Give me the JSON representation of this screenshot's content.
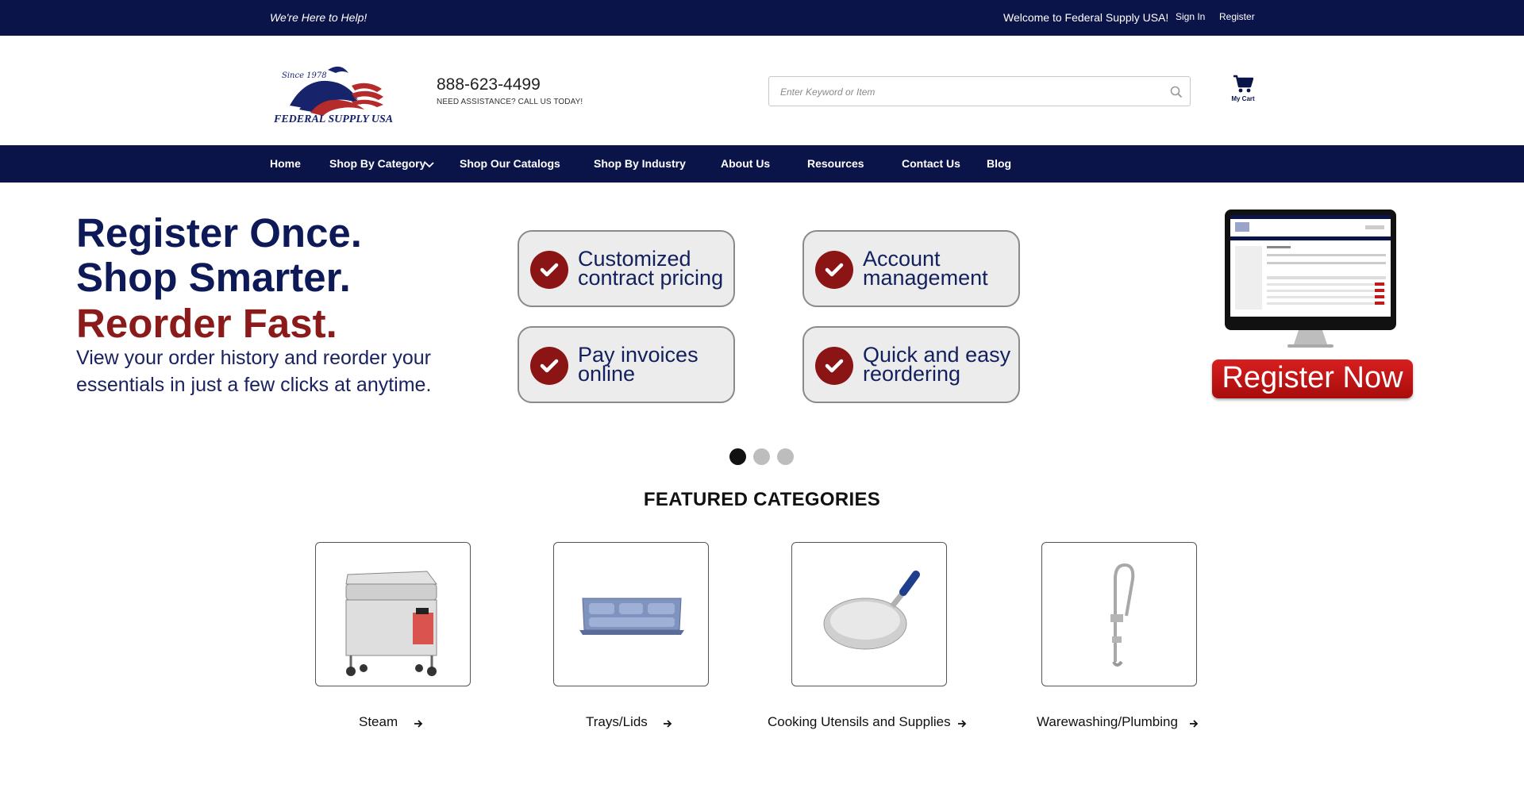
{
  "topbar": {
    "tagline": "We're Here to Help!",
    "welcome": "Welcome to Federal Supply USA!",
    "sign_in": "Sign In",
    "register": "Register"
  },
  "header": {
    "logo_text": "FEDERAL SUPPLY USA",
    "logo_since": "Since 1978",
    "phone": "888-623-4499",
    "assist": "NEED ASSISTANCE? CALL US TODAY!",
    "search_placeholder": "Enter Keyword or Item",
    "search_icon": "search-icon",
    "cart_label": "My Cart",
    "cart_icon": "cart-icon"
  },
  "nav": {
    "items": [
      "Home",
      "Shop By Category",
      "Shop Our Catalogs",
      "Shop By Industry",
      "About Us",
      "Resources",
      "Contact Us",
      "Blog"
    ]
  },
  "banner": {
    "line1": "Register Once.",
    "line2": "Shop Smarter.",
    "line3": "Reorder Fast.",
    "subtext": "View your order history and reorder your essentials in just a few clicks at anytime.",
    "features": [
      "Customized contract pricing",
      "Account management",
      "Pay invoices online",
      "Quick and easy reordering"
    ],
    "cta": "Register Now",
    "slides": 3,
    "active_slide": 1
  },
  "featured": {
    "title": "FEATURED CATEGORIES",
    "categories": [
      "Steam",
      "Trays/Lids",
      "Cooking Utensils and Supplies",
      "Warewashing/Plumbing"
    ]
  },
  "colors": {
    "navy": "#0b1448",
    "headline_navy": "#0d1a57",
    "accent_red": "#8b1a1a",
    "cta_red": "#c91616"
  }
}
